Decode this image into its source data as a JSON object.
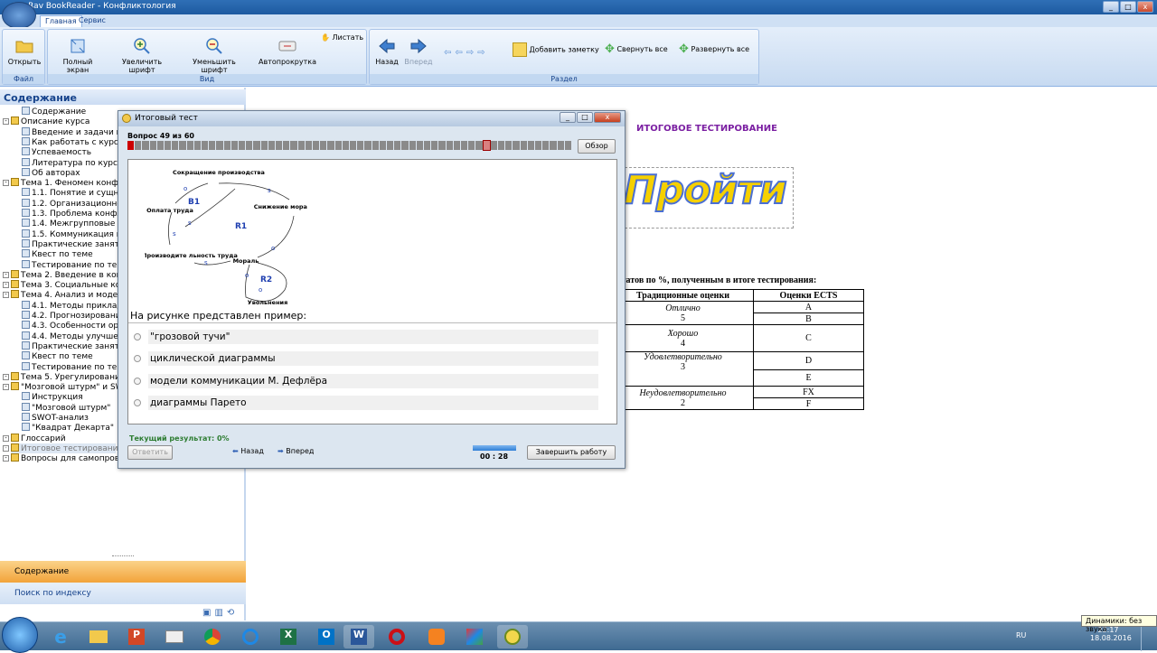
{
  "window": {
    "title": "SunRav BookReader  -  Конфликтология"
  },
  "ribbon_tabs": [
    "Главная",
    "Сервис"
  ],
  "groups": {
    "file": "Файл",
    "view": "Вид",
    "section": "Раздел"
  },
  "buttons": {
    "open": "Открыть",
    "fullscreen": "Полный экран",
    "zoom_in": "Увеличить шрифт",
    "zoom_out": "Уменьшить шрифт",
    "autoscroll": "Автопрокрутка",
    "flip": "Листать",
    "back": "Назад",
    "forward": "Вперед",
    "add_note": "Добавить заметку",
    "collapse_all": "Свернуть все",
    "expand_all": "Развернуть все"
  },
  "left_pane": {
    "header": "Содержание",
    "tree": [
      {
        "label": "Содержание",
        "level": 1
      },
      {
        "label": "Описание курса",
        "level": 0
      },
      {
        "label": "Введение и задачи к",
        "level": 1
      },
      {
        "label": "Как работать с курсо",
        "level": 1
      },
      {
        "label": "Успеваемость",
        "level": 1
      },
      {
        "label": "Литература по курсу",
        "level": 1
      },
      {
        "label": "Об авторах",
        "level": 1
      },
      {
        "label": "Тема 1. Феномен конфл",
        "level": 0
      },
      {
        "label": "1.1. Понятие и сущнос",
        "level": 1
      },
      {
        "label": "1.2. Организационно-",
        "level": 1
      },
      {
        "label": "1.3. Проблема конфли",
        "level": 1
      },
      {
        "label": "1.4. Межгрупповые ко",
        "level": 1
      },
      {
        "label": "1.5. Коммуникация в к",
        "level": 1
      },
      {
        "label": "Практические заняти",
        "level": 1
      },
      {
        "label": "Квест по теме",
        "level": 1
      },
      {
        "label": "Тестирование по тем",
        "level": 1
      },
      {
        "label": "Тема 2. Введение в конс",
        "level": 0
      },
      {
        "label": "Тема 3. Социальные кон",
        "level": 0
      },
      {
        "label": "Тема 4. Анализ и модели",
        "level": 0
      },
      {
        "label": "4.1. Методы приклад",
        "level": 1
      },
      {
        "label": "4.2. Прогнозировани",
        "level": 1
      },
      {
        "label": "4.3. Особенности орг",
        "level": 1
      },
      {
        "label": "4.4. Методы улучшен",
        "level": 1
      },
      {
        "label": "Практические заняти",
        "level": 1
      },
      {
        "label": "Квест по теме",
        "level": 1
      },
      {
        "label": "Тестирование по тем",
        "level": 1
      },
      {
        "label": "Тема 5. Урегулирование",
        "level": 0
      },
      {
        "label": "\"Мозговой штурм\" и SW",
        "level": 0
      },
      {
        "label": "Инструкция",
        "level": 1
      },
      {
        "label": "\"Мозговой штурм\"",
        "level": 1
      },
      {
        "label": "SWOT-анализ",
        "level": 1
      },
      {
        "label": "\"Квадрат Декарта\"",
        "level": 1
      },
      {
        "label": "Глоссарий",
        "level": 0
      },
      {
        "label": "Итоговое тестирование",
        "level": 0
      },
      {
        "label": "Вопросы для самопрове",
        "level": 0
      }
    ],
    "tab_contents": "Содержание",
    "tab_search": "Поиск по индексу"
  },
  "document": {
    "heading": "ИТОГОВОЕ ТЕСТИРОВАНИЕ",
    "go_button": "Пройти",
    "results_caption": "льтатов по %, полученным в итоге тестирования:",
    "table_headers": [
      "Традиционные оценки",
      "Оценки ECTS"
    ],
    "table_rows": [
      {
        "trad_word": "Отлично",
        "trad_num": "5",
        "ects": [
          "A",
          "B"
        ]
      },
      {
        "trad_word": "Хорошо",
        "trad_num": "4",
        "ects": [
          "C"
        ]
      },
      {
        "trad_word": "Удовлетворительно",
        "trad_num": "3",
        "ects": [
          "D",
          "E"
        ]
      },
      {
        "trad_word": "Неудовлетворительно",
        "trad_num": "2",
        "ects": [
          "FX",
          "F"
        ]
      }
    ]
  },
  "dialog": {
    "title": "Итоговый тест",
    "question_counter": "Вопрос 49 из 60",
    "overview_button": "Обзор",
    "progress_total": 60,
    "progress_current": 49,
    "question_text": "На рисунке представлен пример:",
    "options": [
      "\"грозовой тучи\"",
      "циклической диаграммы",
      "модели коммуникации М. Дефлёра",
      "диаграммы Парето"
    ],
    "current_result": "Текущий результат: 0%",
    "answer_button": "Ответить",
    "back_button": "Назад",
    "forward_button": "Вперед",
    "timer": "00 : 28",
    "finish_button": "Завершить работу",
    "diagram": {
      "nodes": [
        "Сокращение производства",
        "Снижение морали",
        "Мораль",
        "Увольнения",
        "Производите льность труда",
        "Оплата труда"
      ],
      "loops": [
        "B1",
        "R1",
        "R2"
      ],
      "signs": [
        "o",
        "s"
      ]
    }
  },
  "taskbar": {
    "lang": "RU",
    "time": "23:17",
    "date": "18.08.2016",
    "tooltip": "Динамики: без звука"
  },
  "colors": {
    "accent": "#15428b",
    "heading": "#7b1fa2",
    "progress_red": "#cc0000",
    "lp_active": "#f7a830"
  }
}
